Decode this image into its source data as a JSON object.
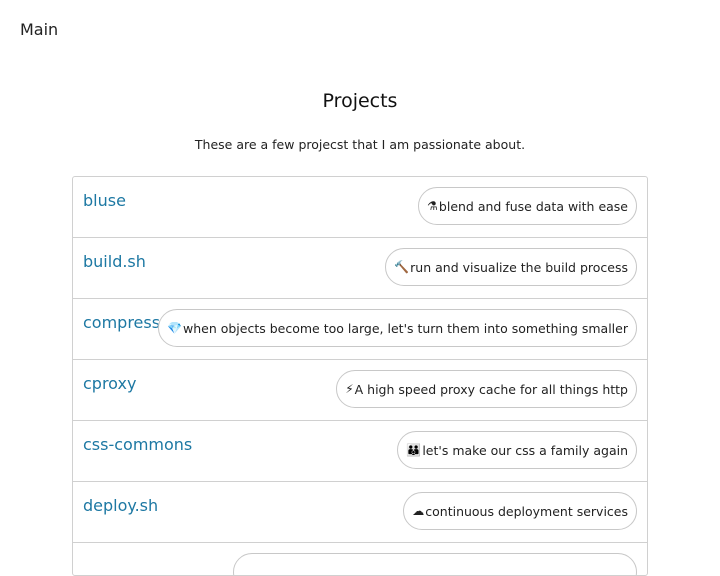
{
  "nav": {
    "main_label": "Main"
  },
  "page": {
    "title": "Projects",
    "subtitle": "These are a few projecst that I am passionate about."
  },
  "projects": [
    {
      "name": "bluse",
      "description": "blend and fuse data with ease",
      "icon": "flask-icon",
      "glyph": "⚗"
    },
    {
      "name": "build.sh",
      "description": "run and visualize the build process",
      "icon": "hammer-icon",
      "glyph": "🔨"
    },
    {
      "name": "compress-object",
      "description": "when objects become too large, let's turn them into something smaller",
      "icon": "gem-icon",
      "glyph": "💎"
    },
    {
      "name": "cproxy",
      "description": "A high speed proxy cache for all things http",
      "icon": "lightning-icon",
      "glyph": "⚡"
    },
    {
      "name": "css-commons",
      "description": "let's make our css a family again",
      "icon": "family-icon",
      "glyph": "👪"
    },
    {
      "name": "deploy.sh",
      "description": "continuous deployment services",
      "icon": "cloud-icon",
      "glyph": "☁"
    },
    {
      "name": "",
      "description": "",
      "icon": "",
      "glyph": ""
    }
  ]
}
